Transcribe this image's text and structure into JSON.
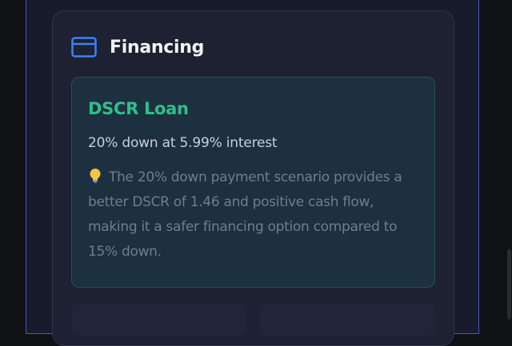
{
  "section": {
    "icon": "credit-card-icon",
    "title": "Financing"
  },
  "loan": {
    "title": "DSCR Loan",
    "terms": "20% down at 5.99% interest",
    "note_icon": "lightbulb-icon",
    "note": "The 20% down payment scenario provides a better DSCR of 1.46 and positive cash flow, making it a safer financing option compared to 15% down."
  },
  "colors": {
    "accent_blue": "#3b82f6",
    "accent_green": "#2fbf8a",
    "frame_border": "#4b54c8"
  }
}
